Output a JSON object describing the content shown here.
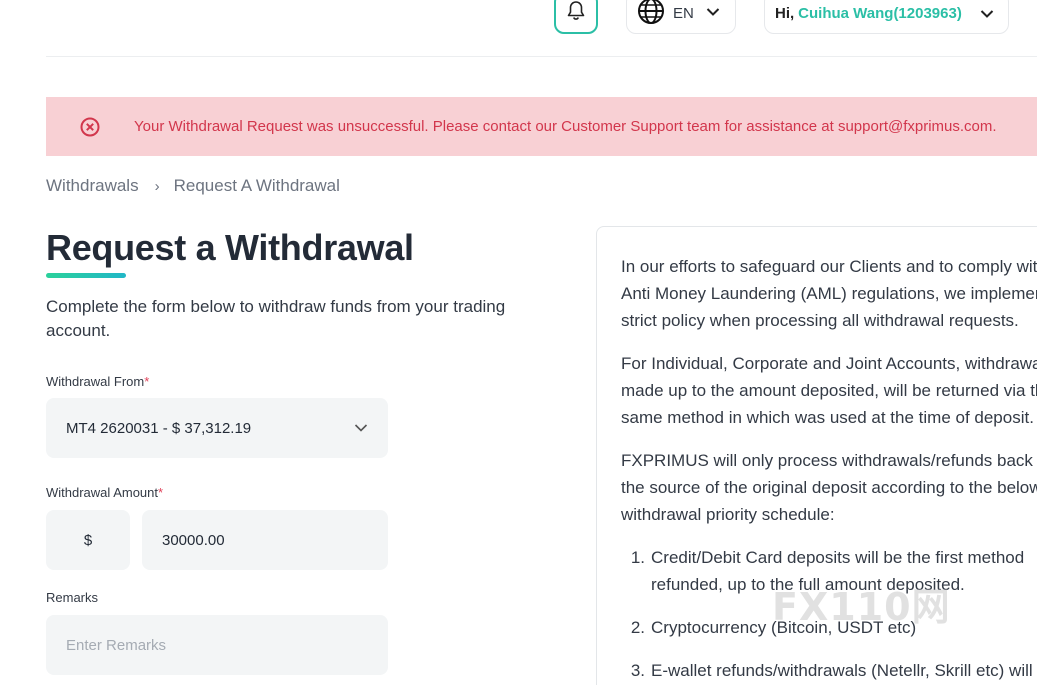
{
  "header": {
    "language": "EN",
    "greeting": "Hi,",
    "user_name": "Cuihua Wang(1203963)"
  },
  "alert": {
    "message": "Your Withdrawal Request was unsuccessful. Please contact our Customer Support team for assistance at support@fxprimus.com."
  },
  "breadcrumb": {
    "parent": "Withdrawals",
    "separator": "›",
    "current": "Request A Withdrawal"
  },
  "form": {
    "title": "Request a Withdrawal",
    "subtitle": "Complete the form below to withdraw funds from your trading account.",
    "withdrawal_from_label": "Withdrawal From",
    "withdrawal_from_value": "MT4 2620031 - $ 37,312.19",
    "withdrawal_amount_label": "Withdrawal Amount",
    "currency_symbol": "$",
    "amount_value": "30000.00",
    "remarks_label": "Remarks",
    "remarks_placeholder": "Enter Remarks",
    "required_mark": "*"
  },
  "info_panel": {
    "p1_lines": [
      "In our efforts to safeguard our Clients and to comply with",
      "Anti Money Laundering (AML) regulations, we implement a",
      "strict policy when processing all withdrawal requests."
    ],
    "p2_lines": [
      "For Individual, Corporate and Joint Accounts, withdrawals",
      "made up to the amount deposited, will be returned via the",
      "same method in which was used at the time of deposit."
    ],
    "p3_lines": [
      "FXPRIMUS will only process withdrawals/refunds back to",
      "the source of the original deposit according to the below",
      "withdrawal priority schedule:"
    ],
    "list": [
      {
        "num": "1.",
        "lines": [
          "Credit/Debit Card deposits will be the first method",
          "refunded, up to the full amount deposited."
        ]
      },
      {
        "num": "2.",
        "lines": [
          "Cryptocurrency (Bitcoin, USDT etc)"
        ]
      },
      {
        "num": "3.",
        "lines": [
          "E-wallet refunds/withdrawals (Netellr, Skrill etc) will"
        ]
      }
    ]
  },
  "watermark": "FX110网",
  "colors": {
    "accent": "#2bbfa6",
    "alert_bg": "#f8d0d4",
    "alert_text": "#d2364c",
    "field_bg": "#f3f5f6"
  }
}
